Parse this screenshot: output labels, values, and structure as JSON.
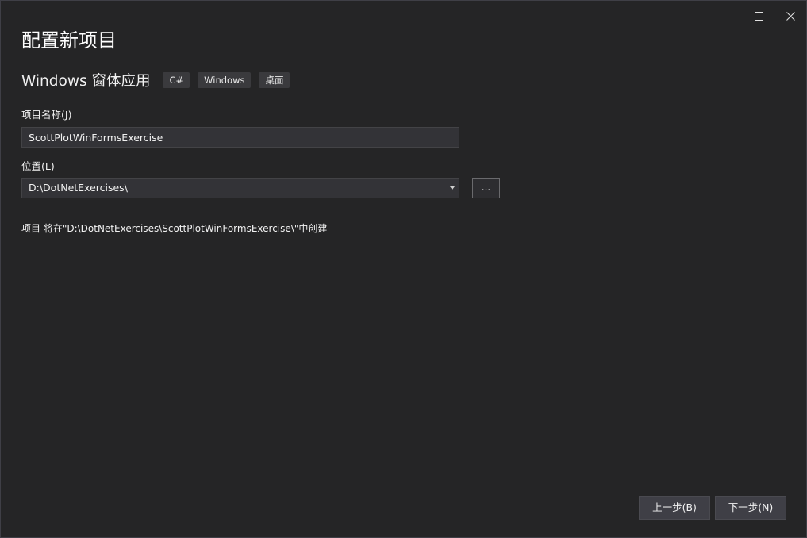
{
  "window": {
    "controls": [
      {
        "icon": "maximize-icon"
      },
      {
        "icon": "close-icon"
      }
    ]
  },
  "page": {
    "title": "配置新项目"
  },
  "template": {
    "name": "Windows 窗体应用",
    "tags": [
      "C#",
      "Windows",
      "桌面"
    ]
  },
  "form": {
    "project_name": {
      "label": "项目名称(J)",
      "value": "ScottPlotWinFormsExercise"
    },
    "location": {
      "label": "位置(L)",
      "value": "D:\\DotNetExercises\\",
      "browse_label": "..."
    },
    "info_text": "项目 将在\"D:\\DotNetExercises\\ScottPlotWinFormsExercise\\\"中创建"
  },
  "footer": {
    "back_label": "上一步(B)",
    "next_label": "下一步(N)"
  },
  "colors": {
    "background": "#252526",
    "input_background": "#333337",
    "button_background": "#3f3f46",
    "text": "#f1f1f1"
  }
}
